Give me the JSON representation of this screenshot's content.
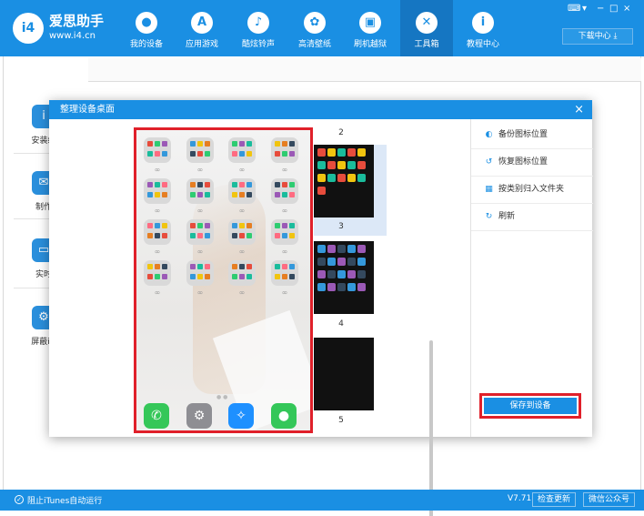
{
  "app": {
    "name": "爱思助手",
    "url": "www.i4.cn",
    "logo_text": "i4"
  },
  "nav": [
    {
      "label": "我的设备",
      "icon": "apple-icon",
      "glyph": "●"
    },
    {
      "label": "应用游戏",
      "icon": "app-store-icon",
      "glyph": "A"
    },
    {
      "label": "酷炫铃声",
      "icon": "bell-icon",
      "glyph": "♪"
    },
    {
      "label": "高清壁纸",
      "icon": "flower-icon",
      "glyph": "✿"
    },
    {
      "label": "刷机越狱",
      "icon": "box-icon",
      "glyph": "▣"
    },
    {
      "label": "工具箱",
      "icon": "tools-icon",
      "glyph": "✕"
    },
    {
      "label": "教程中心",
      "icon": "info-icon",
      "glyph": "i"
    }
  ],
  "window_controls": [
    "⌨",
    "▾",
    "−",
    "□",
    "×"
  ],
  "download_button": "下载中心 ⤓",
  "sidebar": [
    {
      "label": "安装编",
      "icon": "install-icon",
      "glyph": "i"
    },
    {
      "label": "制作",
      "icon": "chat-icon",
      "glyph": "✉"
    },
    {
      "label": "实时",
      "icon": "monitor-icon",
      "glyph": "▭"
    },
    {
      "label": "屏蔽iO",
      "icon": "gear-icon",
      "glyph": "⚙"
    }
  ],
  "dialog": {
    "title": "整理设备桌面",
    "close": "×",
    "pages": [
      "2",
      "3",
      "4",
      "5"
    ],
    "actions": [
      {
        "label": "备份图标位置",
        "icon": "backup-icon",
        "glyph": "◐"
      },
      {
        "label": "恢复图标位置",
        "icon": "restore-icon",
        "glyph": "↺"
      },
      {
        "label": "按类别归入文件夹",
        "icon": "grid-icon",
        "glyph": "▦"
      },
      {
        "label": "刷新",
        "icon": "refresh-icon",
        "glyph": "↻"
      }
    ],
    "save_button": "保存到设备",
    "dock": [
      {
        "icon": "phone-app-icon",
        "color": "#35c759",
        "glyph": "✆"
      },
      {
        "icon": "settings-app-icon",
        "color": "#8e8e93",
        "glyph": "⚙"
      },
      {
        "icon": "safari-app-icon",
        "color": "#1e90ff",
        "glyph": "✧"
      },
      {
        "icon": "messages-app-icon",
        "color": "#34c759",
        "glyph": "●"
      }
    ]
  },
  "status": {
    "itunes_block": "阻止iTunes自动运行",
    "version": "V7.71",
    "check_update": "检查更新",
    "wechat": "微信公众号"
  },
  "colors": {
    "accent": "#1a8fe3",
    "highlight": "#e0202a"
  }
}
